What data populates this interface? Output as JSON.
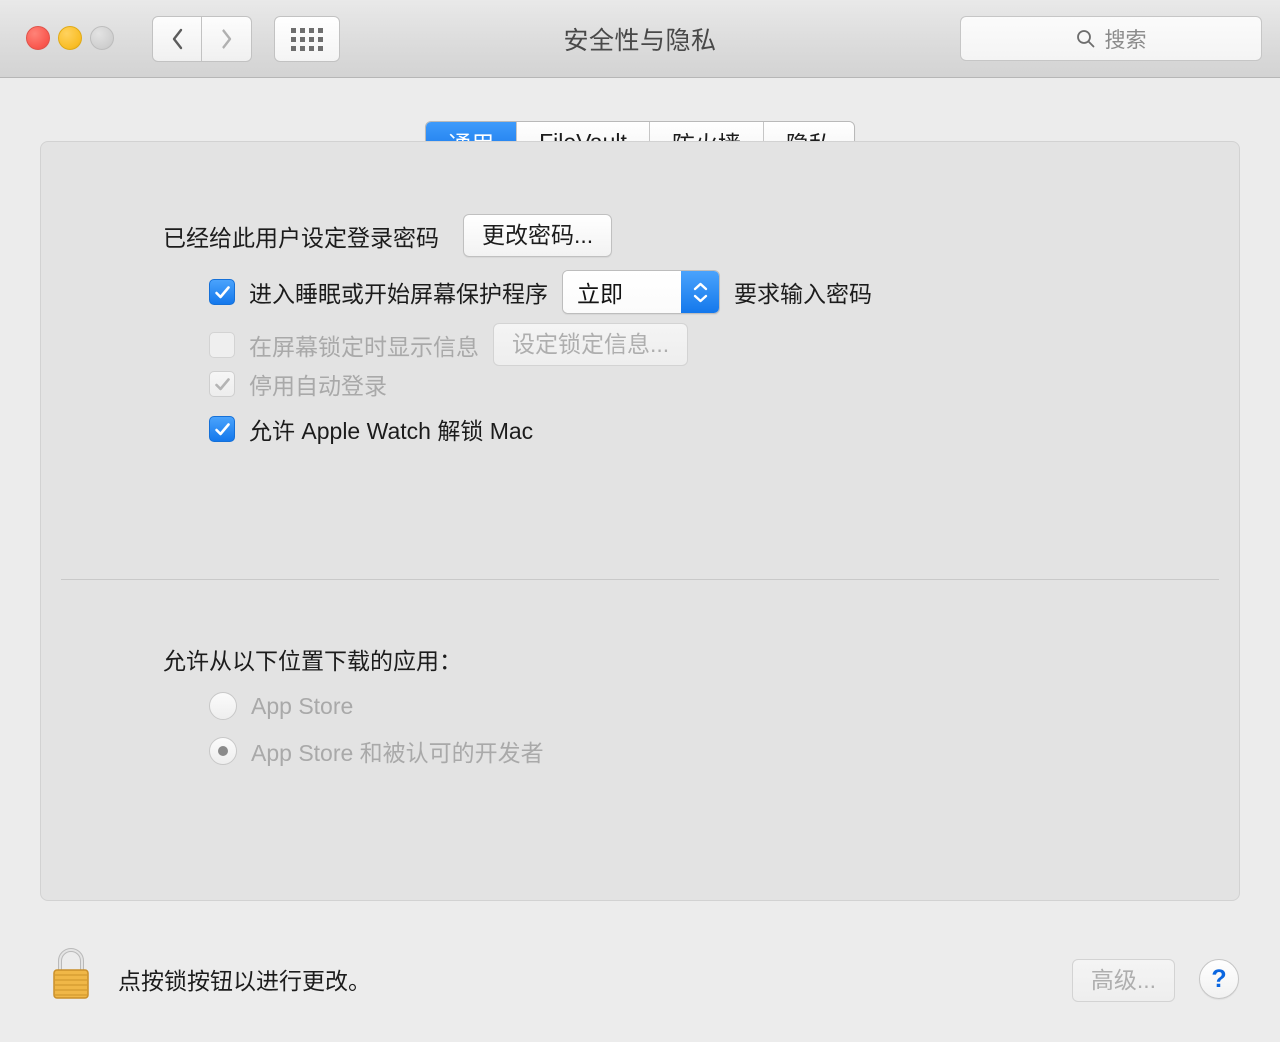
{
  "window": {
    "title": "安全性与隐私",
    "traffic_lights": [
      "close",
      "minimize",
      "zoom-disabled"
    ],
    "nav": {
      "back_icon": "chevron-left-icon",
      "forward_icon": "chevron-right-icon",
      "grid_icon": "show-all-grid-icon"
    },
    "search": {
      "placeholder": "搜索",
      "value": "",
      "icon": "search-icon"
    }
  },
  "tabs": [
    {
      "label": "通用",
      "active": true
    },
    {
      "label": "FileVault",
      "active": false
    },
    {
      "label": "防火墙",
      "active": false
    },
    {
      "label": "隐私",
      "active": false
    }
  ],
  "general": {
    "password_status": "已经给此用户设定登录密码",
    "change_password_button": "更改密码...",
    "require_password": {
      "checkbox_label": "进入睡眠或开始屏幕保护程序",
      "checked": true,
      "delay_value": "立即",
      "trailing_label": "要求输入密码"
    },
    "lock_message": {
      "checkbox_label": "在屏幕锁定时显示信息",
      "checked": false,
      "button_label": "设定锁定信息..."
    },
    "disable_auto_login": {
      "checkbox_label": "停用自动登录",
      "checked": true
    },
    "apple_watch": {
      "checkbox_label": "允许 Apple Watch 解锁 Mac",
      "checked": true
    }
  },
  "download_section": {
    "heading": "允许从以下位置下载的应用：",
    "options": [
      {
        "label": "App Store",
        "selected": false
      },
      {
        "label": "App Store 和被认可的开发者",
        "selected": true
      }
    ]
  },
  "footer": {
    "lock_icon": "padlock-locked-icon",
    "lock_text": "点按锁按钮以进行更改。",
    "advanced_button": "高级...",
    "help_button": "?"
  },
  "colors": {
    "accent_blue": "#1478ec",
    "window_bg": "#ececec",
    "panel_bg": "#e3e3e3",
    "help_blue": "#0a66e0",
    "lock_gold": "#f0b747"
  }
}
